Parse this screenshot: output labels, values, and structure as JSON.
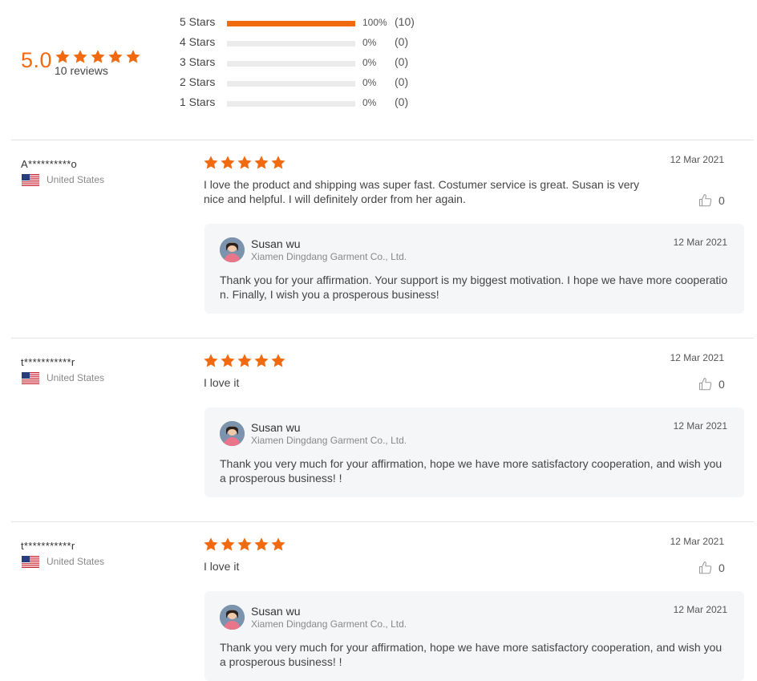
{
  "summary": {
    "average": "5.0",
    "review_count_label": "10 reviews",
    "breakdown": [
      {
        "label": "5  Stars",
        "fraction": 1.0,
        "percent": "100%",
        "count": "(10)"
      },
      {
        "label": "4  Stars",
        "fraction": 0.0,
        "percent": "0%",
        "count": "(0)"
      },
      {
        "label": "3  Stars",
        "fraction": 0.0,
        "percent": "0%",
        "count": "(0)"
      },
      {
        "label": "2  Stars",
        "fraction": 0.0,
        "percent": "0%",
        "count": "(0)"
      },
      {
        "label": "1  Stars",
        "fraction": 0.0,
        "percent": "0%",
        "count": "(0)"
      }
    ]
  },
  "colors": {
    "accent": "#f26a10",
    "track": "#ebebeb",
    "reply_bg": "#f5f6f8"
  },
  "reviews": [
    {
      "user": "A**********o",
      "country": "United States",
      "rating": 5,
      "date": "12 Mar 2021",
      "text": "I love the product and shipping was super fast. Costumer service is great. Susan is very nice and helpful. I will definitely order from her again.",
      "likes": "0",
      "reply": {
        "name": "Susan wu",
        "company": "Xiamen Dingdang Garment Co., Ltd.",
        "date": "12 Mar 2021",
        "text": "Thank you for your affirmation. Your support is my biggest motivation. I hope we have more cooperation. Finally, I wish you a prosperous business!"
      }
    },
    {
      "user": "t***********r",
      "country": "United States",
      "rating": 5,
      "date": "12 Mar 2021",
      "text": "I love it",
      "likes": "0",
      "reply": {
        "name": "Susan wu",
        "company": "Xiamen Dingdang Garment Co., Ltd.",
        "date": "12 Mar 2021",
        "text": "Thank you very much for your affirmation, hope we have more satisfactory cooperation, and wish you a prosperous business! !"
      }
    },
    {
      "user": "t***********r",
      "country": "United States",
      "rating": 5,
      "date": "12 Mar 2021",
      "text": "I love it",
      "likes": "0",
      "reply": {
        "name": "Susan wu",
        "company": "Xiamen Dingdang Garment Co., Ltd.",
        "date": "12 Mar 2021",
        "text": "Thank you very much for your affirmation, hope we have more satisfactory cooperation, and wish you a prosperous business! !"
      }
    }
  ],
  "icons": {
    "star": "star-icon",
    "flag": "us-flag-icon",
    "like": "thumbs-up-icon",
    "avatar": "seller-avatar"
  }
}
